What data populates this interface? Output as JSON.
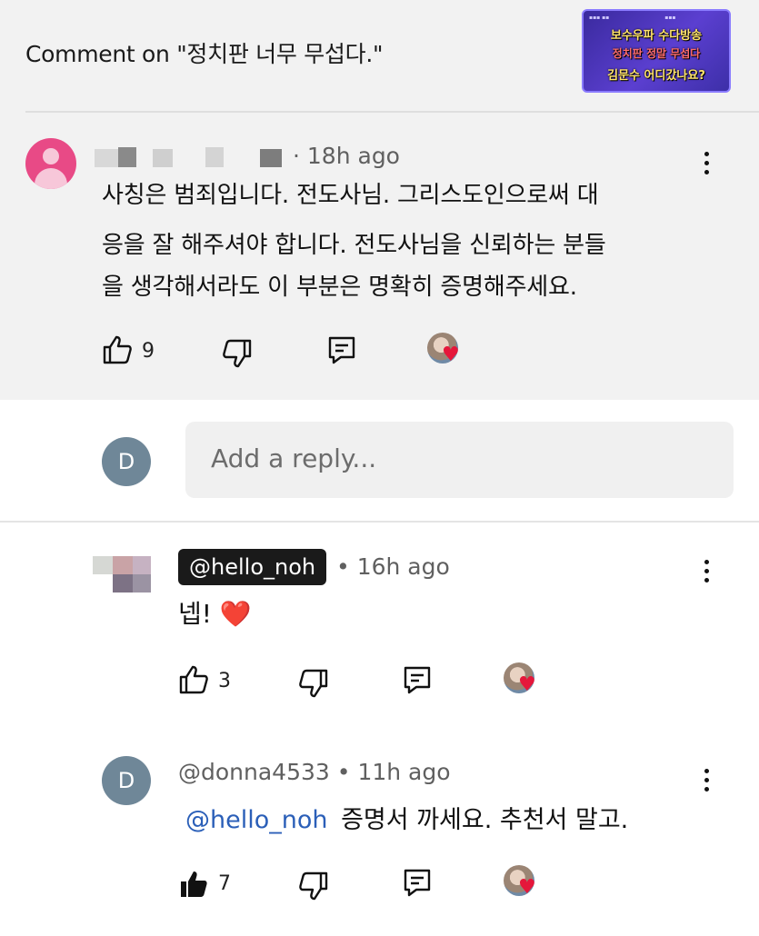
{
  "header": {
    "title": "Comment on \"정치판 너무 무섭다.\"",
    "thumbnail": {
      "line1": "보수우파 수다방송",
      "line2": "정치판 정말 무섭다",
      "line3": "김문수 어디갔나요?"
    }
  },
  "parent_comment": {
    "timestamp": "· 18h ago",
    "text_lines": [
      "사칭은 범죄입니다. 전도사님. 그리스도인으로써 대",
      "응을 잘 해주셔야 합니다. 전도사님을 신뢰하는 분들",
      "을 생각해서라도 이 부분은 명확히 증명해주세요."
    ],
    "likes": "9"
  },
  "reply_input": {
    "avatar_letter": "D",
    "placeholder": "Add a reply..."
  },
  "replies": [
    {
      "author": "@hello_noh",
      "timestamp": "• 16h ago",
      "text": "넵!",
      "emoji": "❤️",
      "likes": "3"
    },
    {
      "avatar_letter": "D",
      "author": "@donna4533",
      "timestamp": "• 11h ago",
      "mention": "@hello_noh",
      "text": "증명서 까세요. 추천서 말고.",
      "likes": "7"
    }
  ],
  "colors": {
    "pink_avatar": "#e84a86",
    "d_avatar": "#6f8798",
    "mention_blue": "#2b5fb8",
    "heart_red": "#e5173b"
  },
  "icons": [
    "thumbs-up-icon",
    "thumbs-down-icon",
    "reply-icon",
    "creator-heart-icon",
    "more-vert-icon"
  ]
}
